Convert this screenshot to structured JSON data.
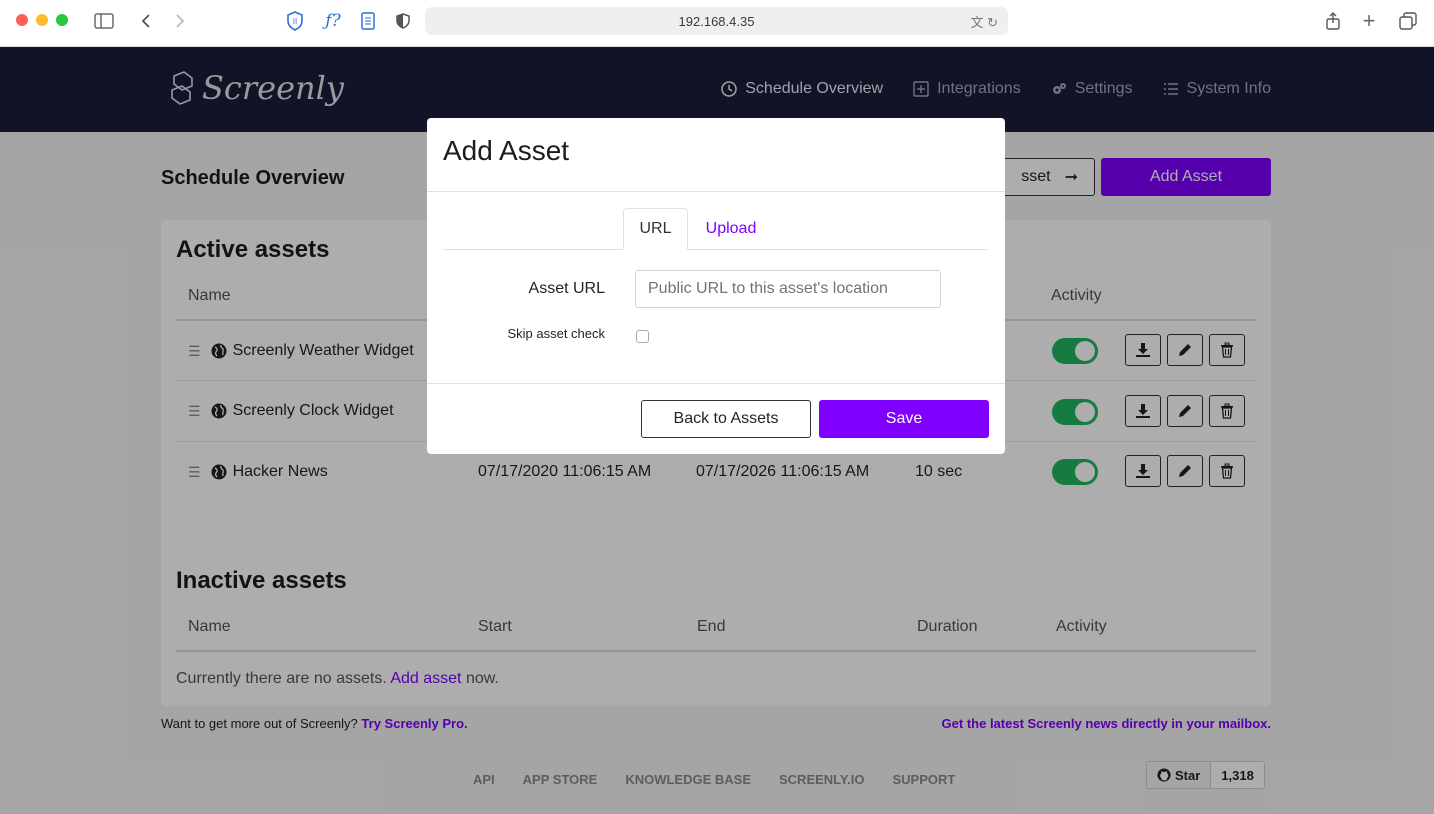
{
  "browser": {
    "url": "192.168.4.35"
  },
  "app": {
    "logo_text": "Screenly",
    "nav": [
      {
        "label": "Schedule Overview",
        "icon": "clock-icon",
        "active": true
      },
      {
        "label": "Integrations",
        "icon": "plus-square-icon",
        "active": false
      },
      {
        "label": "Settings",
        "icon": "gears-icon",
        "active": false
      },
      {
        "label": "System Info",
        "icon": "list-icon",
        "active": false
      }
    ]
  },
  "page": {
    "title": "Schedule Overview",
    "top_button_partial": "sset",
    "add_asset_button": "Add Asset"
  },
  "active": {
    "title": "Active assets",
    "headers": {
      "name": "Name",
      "activity": "Activity"
    },
    "rows": [
      {
        "name": "Screenly Weather Widget",
        "start": "",
        "end": "",
        "duration": ""
      },
      {
        "name": "Screenly Clock Widget",
        "start": "",
        "end": "",
        "duration": ""
      },
      {
        "name": "Hacker News",
        "start": "07/17/2020 11:06:15 AM",
        "end": "07/17/2026 11:06:15 AM",
        "duration": "10 sec"
      }
    ]
  },
  "inactive": {
    "title": "Inactive assets",
    "headers": {
      "name": "Name",
      "start": "Start",
      "end": "End",
      "duration": "Duration",
      "activity": "Activity"
    },
    "empty_prefix": "Currently there are no assets.",
    "empty_link": "Add asset",
    "empty_suffix": "now."
  },
  "footer": {
    "left_text": "Want to get more out of Screenly?",
    "left_link": "Try Screenly Pro.",
    "right_link": "Get the latest Screenly news directly in your mailbox.",
    "links": [
      "API",
      "APP STORE",
      "KNOWLEDGE BASE",
      "SCREENLY.IO",
      "SUPPORT"
    ],
    "github_star_label": "Star",
    "github_star_count": "1,318"
  },
  "modal": {
    "title": "Add Asset",
    "tabs": {
      "url": "URL",
      "upload": "Upload"
    },
    "asset_url_label": "Asset URL",
    "asset_url_placeholder": "Public URL to this asset's location",
    "skip_check_label": "Skip asset check",
    "back_button": "Back to Assets",
    "save_button": "Save"
  },
  "colors": {
    "brand": "#7f00ff",
    "navbar": "#1b1d3a",
    "toggle_on": "#1fb55f"
  }
}
